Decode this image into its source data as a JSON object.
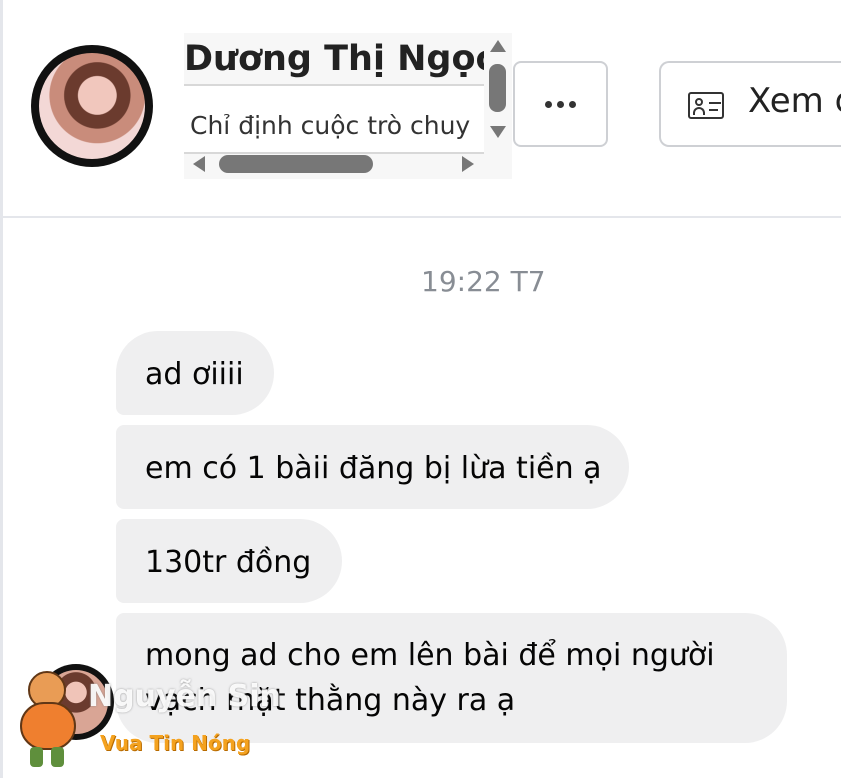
{
  "header": {
    "contact_name": "Dương Thị Ngọc",
    "subtitle": "Chỉ định cuộc trò chuy",
    "more_button_label": "•••",
    "profile_button_label": "Xem d"
  },
  "conversation": {
    "timestamp": "19:22 T7",
    "messages": [
      "ad ơiiii",
      "em có 1 bàii đăng bị lừa tiền ạ",
      "130tr đồng",
      "mong ad cho em lên bài để mọi người",
      "vạch mặt thằng này ra ạ"
    ]
  },
  "watermark": {
    "name": "Nguyễn Sin",
    "tagline": "Vua Tin Nóng"
  },
  "icons": {
    "more": "more-horizontal-icon",
    "profile": "id-card-icon"
  },
  "colors": {
    "bubble": "#efeff0",
    "border": "#ced0d4",
    "timestamp": "#888d94"
  }
}
